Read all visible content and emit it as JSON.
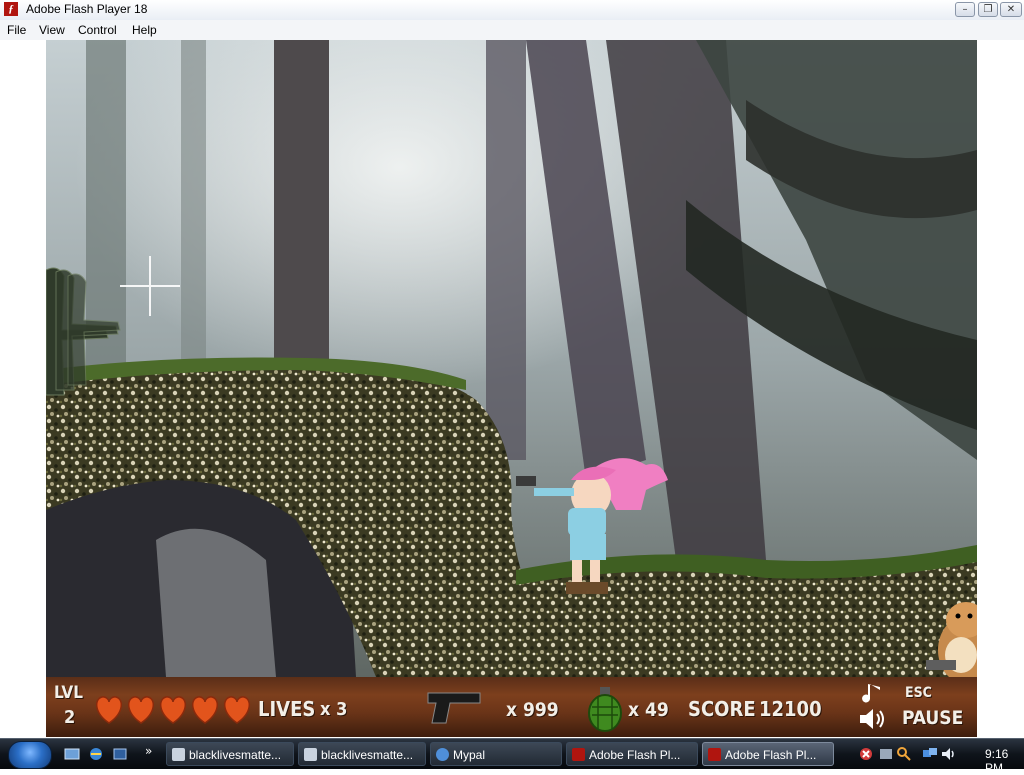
{
  "window": {
    "title": "Adobe Flash Player 18",
    "minimize": "–",
    "maximize": "❐",
    "close": "✕"
  },
  "menu": [
    "File",
    "View",
    "Control",
    "Help"
  ],
  "hud": {
    "level_label": "LVL",
    "level_value": "2",
    "hearts": 5,
    "lives_label": "LIVES",
    "lives_value": "x 3",
    "ammo_value": "x 999",
    "grenades_value": "x 49",
    "score_label": "SCORE",
    "score_value": "12100",
    "esc_label": "ESC",
    "pause_label": "PAUSE"
  },
  "taskbar": {
    "buttons": [
      {
        "label": "blacklivesmatte...",
        "icon_color": "#c9d3df",
        "active": false
      },
      {
        "label": "blacklivesmatte...",
        "icon_color": "#c9d3df",
        "active": false
      },
      {
        "label": "Mypal",
        "icon_color": "#4f8fd9",
        "active": false
      },
      {
        "label": "Adobe Flash Pl...",
        "icon_color": "#b0150f",
        "active": false
      },
      {
        "label": "Adobe Flash Pl...",
        "icon_color": "#b0150f",
        "active": true
      }
    ],
    "quicklaunch_more": "»",
    "clock": "9:16 PM"
  },
  "colors": {
    "heart": "#e2541c",
    "grenade": "#3f8a1f",
    "hud_text": "#f3efe8"
  }
}
